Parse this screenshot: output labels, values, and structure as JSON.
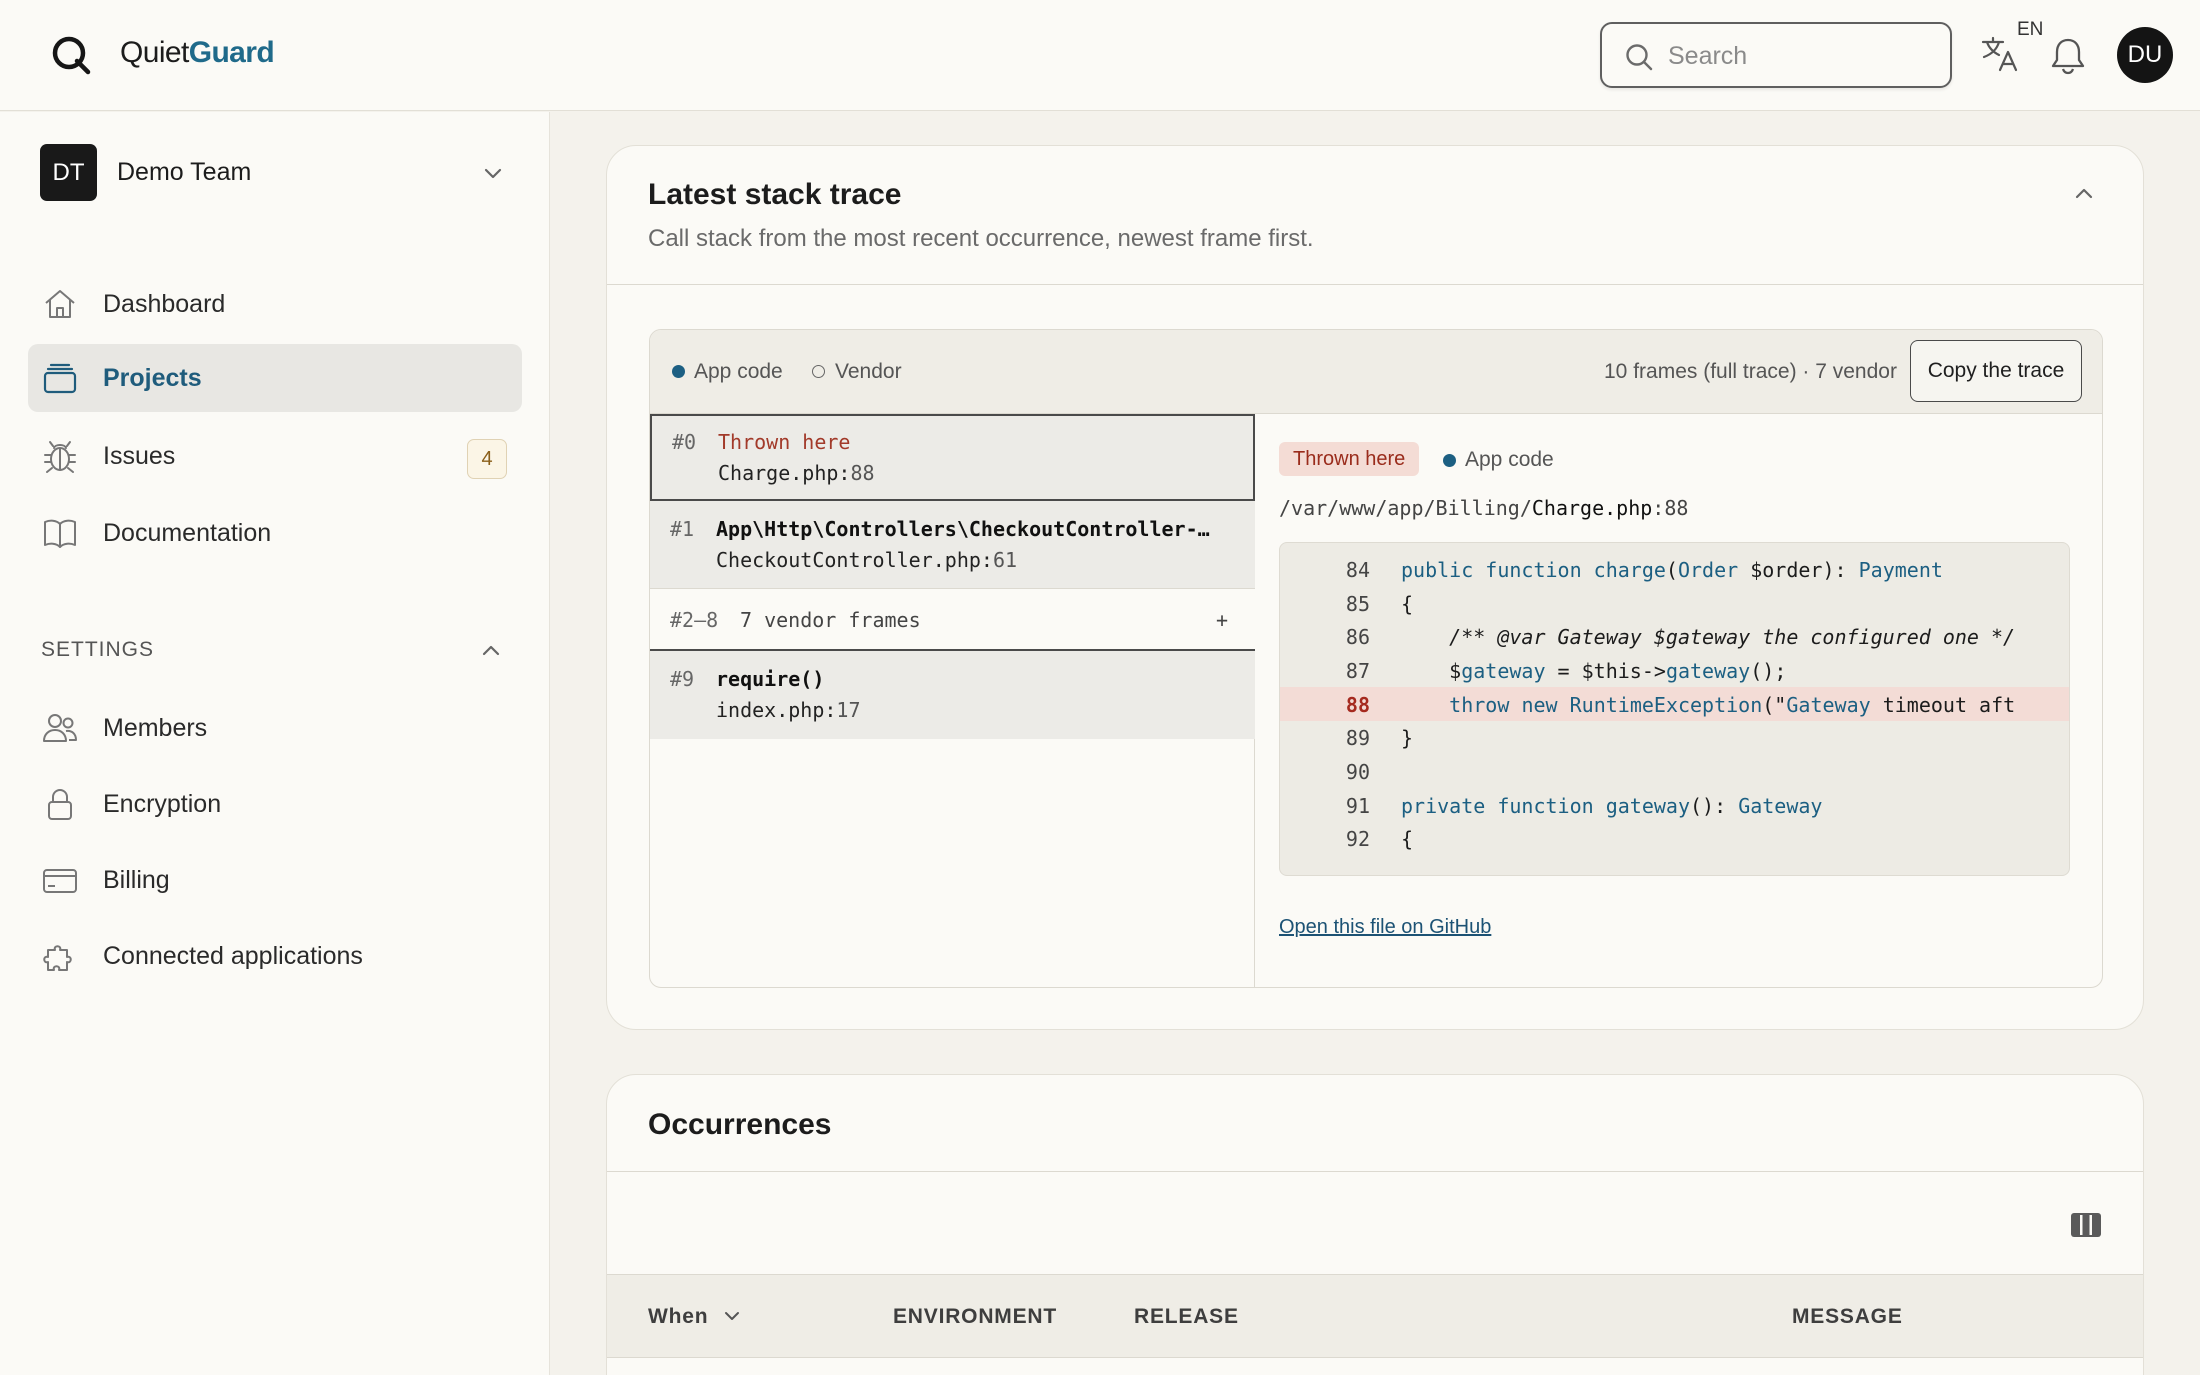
{
  "header": {
    "brand_prefix": "Quiet",
    "brand_accent": "Guard",
    "search_placeholder": "Search",
    "language": "EN",
    "user_initials": "DU"
  },
  "sidebar": {
    "team_initials": "DT",
    "team_name": "Demo Team",
    "nav": [
      {
        "label": "Dashboard",
        "icon": "home-icon"
      },
      {
        "label": "Projects",
        "icon": "folder-stack-icon",
        "active": true
      },
      {
        "label": "Issues",
        "icon": "bug-icon",
        "count": "4"
      },
      {
        "label": "Documentation",
        "icon": "book-icon"
      }
    ],
    "settings_heading": "SETTINGS",
    "settings": [
      {
        "label": "Members",
        "icon": "users-icon"
      },
      {
        "label": "Encryption",
        "icon": "lock-icon"
      },
      {
        "label": "Billing",
        "icon": "credit-card-icon"
      },
      {
        "label": "Connected applications",
        "icon": "puzzle-icon"
      }
    ]
  },
  "stack_card": {
    "title": "Latest stack trace",
    "subtitle": "Call stack from the most recent occurrence, newest frame first.",
    "legend_app": "App code",
    "legend_vendor": "Vendor",
    "frames_info": "10 frames (full trace) · 7 vendor",
    "copy_label": "Copy the trace",
    "frames": [
      {
        "num": "#0",
        "fn": "Thrown here",
        "file": "Charge.php",
        "line": "88"
      },
      {
        "num": "#1",
        "fn": "App\\Http\\Controllers\\CheckoutController-…",
        "file": "CheckoutController.php",
        "line": "61"
      },
      {
        "num": "#2–8",
        "fn": "7 vendor frames",
        "expand": "+"
      },
      {
        "num": "#9",
        "fn": "require()",
        "file": "index.php",
        "line": "17"
      }
    ],
    "detail": {
      "tag": "Thrown here",
      "kind": "App code",
      "path_dir": "/var/www/app/Billing/",
      "path_file": "Charge.php",
      "path_line": "88",
      "code": [
        {
          "no": "84",
          "text": "public function charge(Order $order): Payment"
        },
        {
          "no": "85",
          "text": "{"
        },
        {
          "no": "86",
          "text": "    /** @var Gateway $gateway the configured one */"
        },
        {
          "no": "87",
          "text": "    $gateway = $this->gateway();"
        },
        {
          "no": "88",
          "text": "    throw new RuntimeException(\"Gateway timeout aft",
          "highlight": true
        },
        {
          "no": "89",
          "text": "}"
        },
        {
          "no": "90",
          "text": ""
        },
        {
          "no": "91",
          "text": "private function gateway(): Gateway"
        },
        {
          "no": "92",
          "text": "{"
        }
      ],
      "github_link": "Open this file on GitHub"
    }
  },
  "occurrences_card": {
    "title": "Occurrences",
    "columns": [
      "When",
      "ENVIRONMENT",
      "RELEASE",
      "MESSAGE"
    ]
  },
  "colors": {
    "accent": "#1f6a8a",
    "app_code_dot": "#1c5f82",
    "thrown": "#a23a2a"
  }
}
